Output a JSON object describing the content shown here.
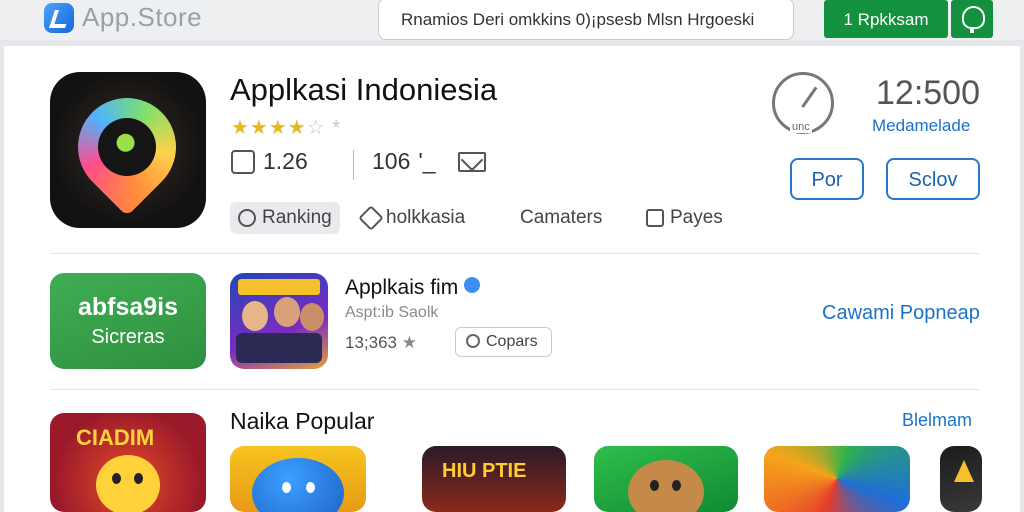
{
  "topbar": {
    "logo_text": "App.Store",
    "search_value": "Rnamios Deri omkkins 0)¡psesb Mlsn Hrgoeski",
    "primary_button_label": "1 Rpkksam"
  },
  "app": {
    "title": "Applkasi Indoniesia",
    "rating_stars": 3.5,
    "stat_1": "1.26",
    "stat_2": "106",
    "stat_2_suffix": "'_",
    "tabs": [
      {
        "label": "Ranking",
        "active": true
      },
      {
        "label": "holkkasia",
        "active": false
      },
      {
        "label": "Camaters",
        "active": false
      },
      {
        "label": "Payes",
        "active": false
      }
    ],
    "timer_label": "unc",
    "big_number": "12:500",
    "big_number_sub": "Medamelade",
    "button_1": "Por",
    "button_2": "Sclov"
  },
  "featured": {
    "banner_line_1": "abfsa9is",
    "banner_line_2": "Sicreras",
    "name": "Applkais fim",
    "subtitle": "Aspt:ib Saolk",
    "rating": "13;363",
    "chip_label": "Copars",
    "link": "Cawami Popneap"
  },
  "popular": {
    "title": "Naika Popular",
    "see_all": "Blelmam",
    "tile_caption": "CIADIM",
    "game_caption": "HIU PTIE"
  },
  "colors": {
    "accent_green": "#14913f",
    "link_blue": "#1a73c8",
    "star_gold": "#e7b91a"
  }
}
